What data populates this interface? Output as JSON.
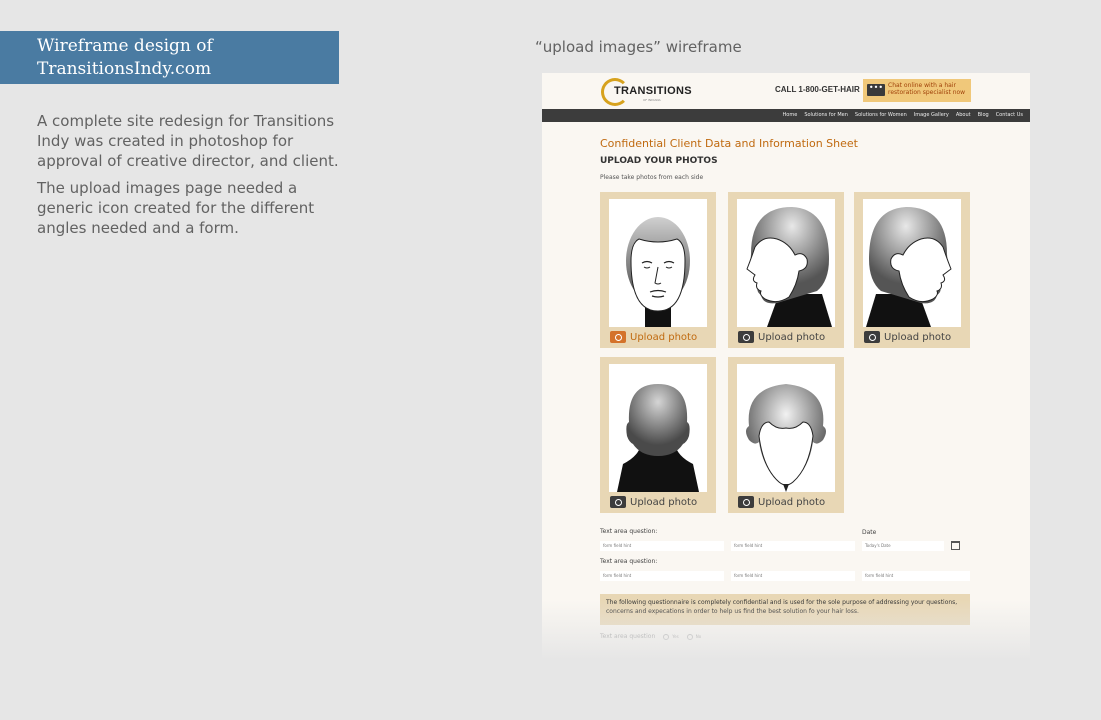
{
  "left_panel": {
    "title_line1": "Wireframe design of",
    "title_line2": "TransitionsIndy.com",
    "para1": "A complete site redesign for Transitions Indy was created in photoshop for approval of creative director, and client.",
    "para2": "The upload images page needed a generic icon created for the different angles needed and a form."
  },
  "caption": "“upload images” wireframe",
  "site": {
    "logo_text": "TRANSITIONS",
    "logo_sub": "OF INDIANA",
    "phone": "CALL 1-800-GET-HAIR",
    "chat": "Chat online with a hair restoration specialist now",
    "nav": [
      "Home",
      "Solutions for Men",
      "Solutions for Women",
      "Image Gallery",
      "About",
      "Blog",
      "Contact Us"
    ],
    "page_title": "Confidential Client Data and Information Sheet",
    "section_title": "UPLOAD YOUR PHOTOS",
    "note": "Please take photos from each side",
    "upload_label": "Upload photo",
    "cards": [
      {
        "view": "front",
        "active": true
      },
      {
        "view": "left-side",
        "active": false
      },
      {
        "view": "right-side",
        "active": false
      },
      {
        "view": "back",
        "active": false
      },
      {
        "view": "top",
        "active": false
      }
    ],
    "form": {
      "label1": "Text area question:",
      "label2": "Text area question:",
      "date_label": "Date",
      "field_hint": "form field hint",
      "date_hint": "Today's Date",
      "notice": "The following questionnaire is completely confidential and is used for the sole purpose of addressing your questions, concerns and expecations in order to help us find the best solution fo your hair loss.",
      "question": "Text area question",
      "yes": "Yes",
      "no": "No"
    }
  },
  "colors": {
    "title_bg": "#4a7ba2",
    "accent_orange": "#c06a10",
    "card_bg": "#e8d7b5",
    "nav_bg": "#3c3c3c"
  }
}
